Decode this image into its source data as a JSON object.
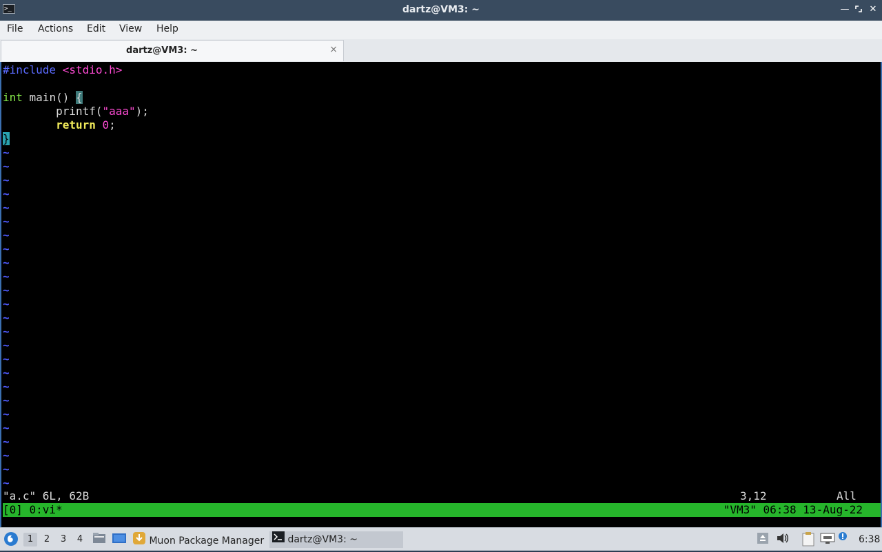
{
  "window": {
    "title": "dartz@VM3: ~",
    "app_icon": "terminal-icon",
    "controls": [
      "minimize-icon",
      "maximize-icon",
      "close-icon"
    ]
  },
  "menu": [
    "File",
    "Actions",
    "Edit",
    "View",
    "Help"
  ],
  "tabs": [
    {
      "label": "dartz@VM3: ~",
      "close": "×"
    }
  ],
  "editor": {
    "code": {
      "line1_pre": "#include",
      "line1_hdr": "<stdio.h>",
      "line3_type": "int",
      "line3_rest": " main() ",
      "line3_brace": "{",
      "line4_indent": "        printf(",
      "line4_str": "\"aaa\"",
      "line4_end": ");",
      "line5_indent": "        ",
      "line5_kw": "return",
      "line5_num": "0",
      "line5_end": ";",
      "line6_brace": "}"
    },
    "tilde": "~",
    "message": "\"a.c\" 6L, 62B",
    "position": "3,12",
    "scroll": "All"
  },
  "tmux": {
    "left": "[0] 0:vi*",
    "right": "\"VM3\" 06:38 13-Aug-22"
  },
  "taskbar": {
    "workspaces": [
      "1",
      "2",
      "3",
      "4"
    ],
    "active_workspace": "1",
    "apps": [
      {
        "label": "Muon Package Manager",
        "icon": "package-manager-icon"
      },
      {
        "label": "dartz@VM3: ~",
        "icon": "terminal-icon"
      }
    ],
    "clock": "6:38"
  },
  "colors": {
    "tmux_bar": "#26b52b",
    "terminal_bg": "#000000",
    "window_border": "#3b6fb0"
  }
}
